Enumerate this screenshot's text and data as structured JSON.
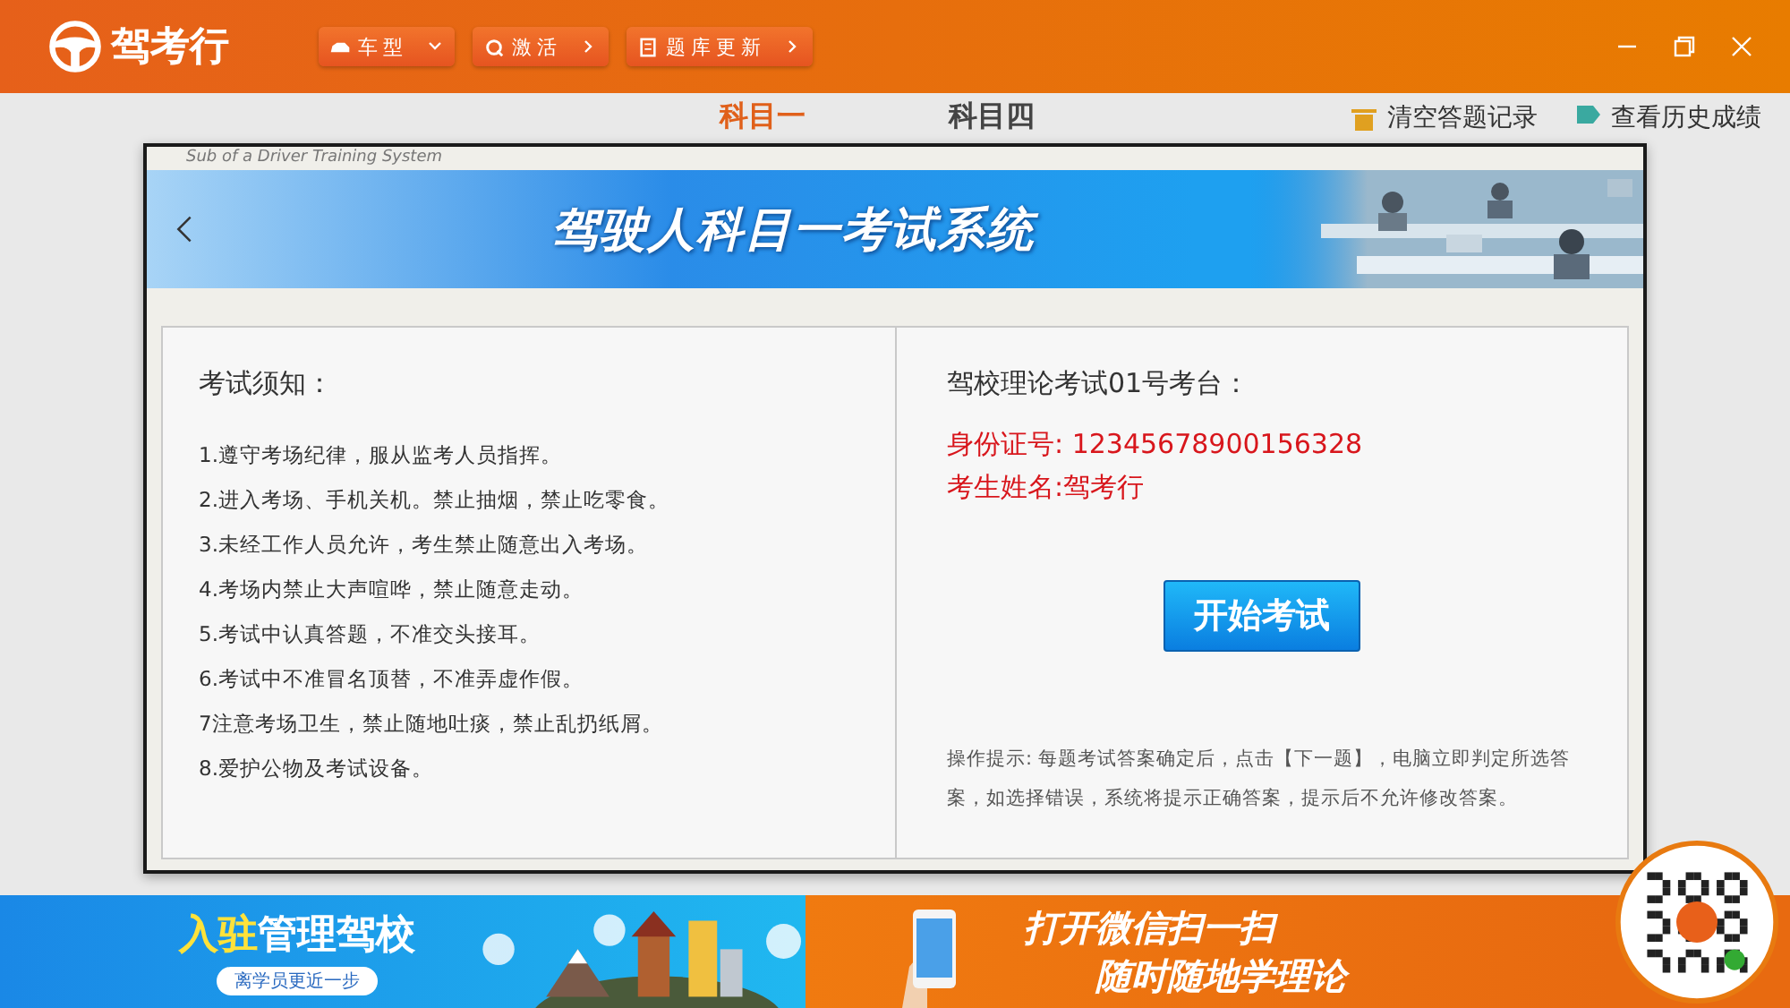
{
  "app": {
    "logo_text": "驾考行"
  },
  "toolbar": [
    {
      "label": "车型",
      "kind": "dropdown"
    },
    {
      "label": "激活",
      "kind": "link"
    },
    {
      "label": "题库更新",
      "kind": "link"
    }
  ],
  "tabs": [
    {
      "label": "科目一",
      "selected": true
    },
    {
      "label": "科目四",
      "selected": false
    }
  ],
  "actions": [
    {
      "label": "清空答题记录",
      "kind": "trash"
    },
    {
      "label": "查看历史成绩",
      "kind": "record"
    }
  ],
  "dialog": {
    "subtitle": "Sub of a Driver Training System",
    "title": "驾驶人科目一考试系统",
    "rules_title": "考试须知：",
    "rules": [
      "1.遵守考场纪律，服从监考人员指挥。",
      "2.进入考场、手机关机。禁止抽烟，禁止吃零食。",
      "3.未经工作人员允许，考生禁止随意出入考场。",
      "4.考场内禁止大声喧哗，禁止随意走动。",
      "5.考试中认真答题，不准交头接耳。",
      "6.考试中不准冒名顶替，不准弄虚作假。",
      "7注意考场卫生，禁止随地吐痰，禁止乱扔纸屑。",
      "8.爱护公物及考试设备。"
    ],
    "station": "驾校理论考试01号考台：",
    "id_line": "身份证号: 12345678900156328",
    "name_line": "考生姓名:驾考行",
    "start_button": "开始考试",
    "hint": "操作提示: 每题考试答案确定后，点击【下一题】，电脑立即判定所选答案，如选择错误，系统将提示正确答案，提示后不允许修改答案。"
  },
  "banners": [
    {
      "kind": "school",
      "title_a": "入驻",
      "title_b": "管理驾校",
      "subtitle": "离学员更近一步"
    },
    {
      "kind": "wechat",
      "title_a": "打开微信扫一扫",
      "title_b": "随时随地学理论"
    }
  ]
}
